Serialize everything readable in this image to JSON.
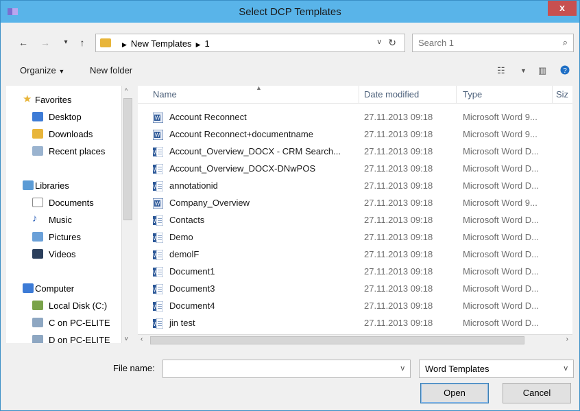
{
  "window": {
    "title": "Select DCP Templates",
    "close_label": "x"
  },
  "nav": {
    "back_glyph": "←",
    "forward_glyph": "→",
    "recent_glyph": "▾",
    "up_glyph": "↑",
    "breadcrumbs": [
      "New Templates",
      "1"
    ],
    "address_dropdown_glyph": "v",
    "refresh_glyph": "↻"
  },
  "search": {
    "placeholder": "Search 1",
    "icon_glyph": "⌕"
  },
  "toolbar": {
    "organize_label": "Organize",
    "new_folder_label": "New folder"
  },
  "sidebar": {
    "favorites_label": "Favorites",
    "desktop_label": "Desktop",
    "downloads_label": "Downloads",
    "recent_label": "Recent places",
    "libraries_label": "Libraries",
    "documents_label": "Documents",
    "music_label": "Music",
    "pictures_label": "Pictures",
    "videos_label": "Videos",
    "computer_label": "Computer",
    "local_disk_label": "Local Disk (C:)",
    "c_pc_label": "C on PC-ELITE",
    "d_pc_label": "D on PC-ELITE"
  },
  "columns": {
    "name": "Name",
    "date": "Date modified",
    "type": "Type",
    "size": "Siz"
  },
  "files": [
    {
      "name": "Account Reconnect",
      "date": "27.11.2013 09:18",
      "type": "Microsoft Word 9...",
      "kind": "word97"
    },
    {
      "name": "Account Reconnect+documentname",
      "date": "27.11.2013 09:18",
      "type": "Microsoft Word 9...",
      "kind": "word97"
    },
    {
      "name": "Account_Overview_DOCX - CRM Search...",
      "date": "27.11.2013 09:18",
      "type": "Microsoft Word D...",
      "kind": "docx"
    },
    {
      "name": "Account_Overview_DOCX-DNwPOS",
      "date": "27.11.2013 09:18",
      "type": "Microsoft Word D...",
      "kind": "docx"
    },
    {
      "name": "annotationid",
      "date": "27.11.2013 09:18",
      "type": "Microsoft Word D...",
      "kind": "docx"
    },
    {
      "name": "Company_Overview",
      "date": "27.11.2013 09:18",
      "type": "Microsoft Word 9...",
      "kind": "word97"
    },
    {
      "name": "Contacts",
      "date": "27.11.2013 09:18",
      "type": "Microsoft Word D...",
      "kind": "docx"
    },
    {
      "name": "Demo",
      "date": "27.11.2013 09:18",
      "type": "Microsoft Word D...",
      "kind": "docx"
    },
    {
      "name": "demolF",
      "date": "27.11.2013 09:18",
      "type": "Microsoft Word D...",
      "kind": "docx"
    },
    {
      "name": "Document1",
      "date": "27.11.2013 09:18",
      "type": "Microsoft Word D...",
      "kind": "docx"
    },
    {
      "name": "Document3",
      "date": "27.11.2013 09:18",
      "type": "Microsoft Word D...",
      "kind": "docx"
    },
    {
      "name": "Document4",
      "date": "27.11.2013 09:18",
      "type": "Microsoft Word D...",
      "kind": "docx"
    },
    {
      "name": "jin test",
      "date": "27.11.2013 09:18",
      "type": "Microsoft Word D...",
      "kind": "docx"
    }
  ],
  "bottom": {
    "file_name_label": "File name:",
    "file_name_value": "",
    "file_type_value": "Word Templates",
    "open_label": "Open",
    "cancel_label": "Cancel"
  },
  "colors": {
    "titlebar": "#59b4e9",
    "close": "#c75050",
    "header_text": "#4c607a"
  }
}
